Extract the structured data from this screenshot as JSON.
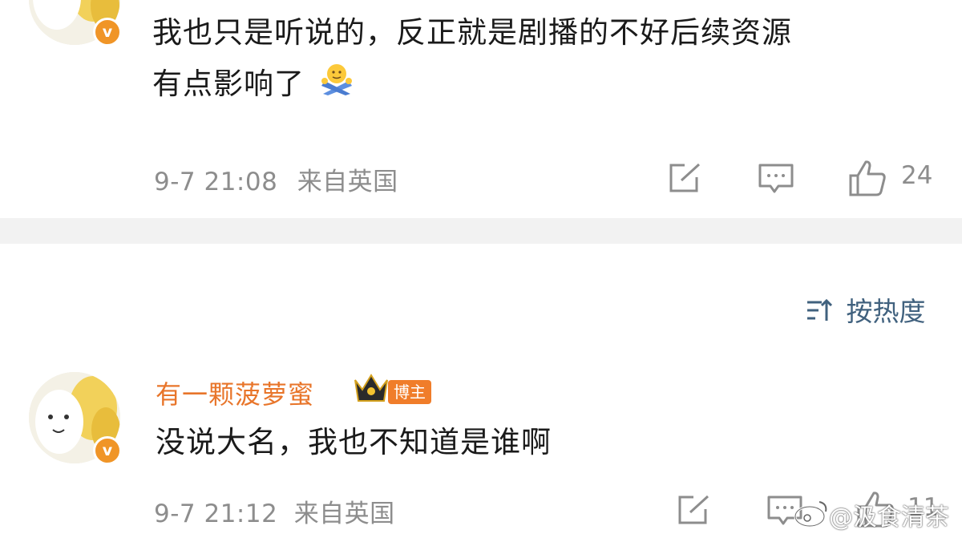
{
  "comment1": {
    "text_line1": "我也只是听说的，反正就是剧播的不好后续资源",
    "text_line2": "有点影响了",
    "time": "9-7 21:08",
    "location": "来自英国",
    "likes": "24",
    "verified_badge": "v"
  },
  "sort": {
    "label": "按热度",
    "icon": "sort-icon"
  },
  "comment2": {
    "username": "有一颗菠萝蜜",
    "role_badge": "博主",
    "text": "没说大名，我也不知道是谁啊",
    "time": "9-7 21:12",
    "location": "来自英国",
    "likes": "11",
    "verified_badge": "v"
  },
  "watermark": {
    "text": "@汲食清茶"
  },
  "colors": {
    "username": "#e8752a",
    "verified": "#f09527",
    "sort": "#40617e",
    "meta": "#8d8d8d"
  }
}
